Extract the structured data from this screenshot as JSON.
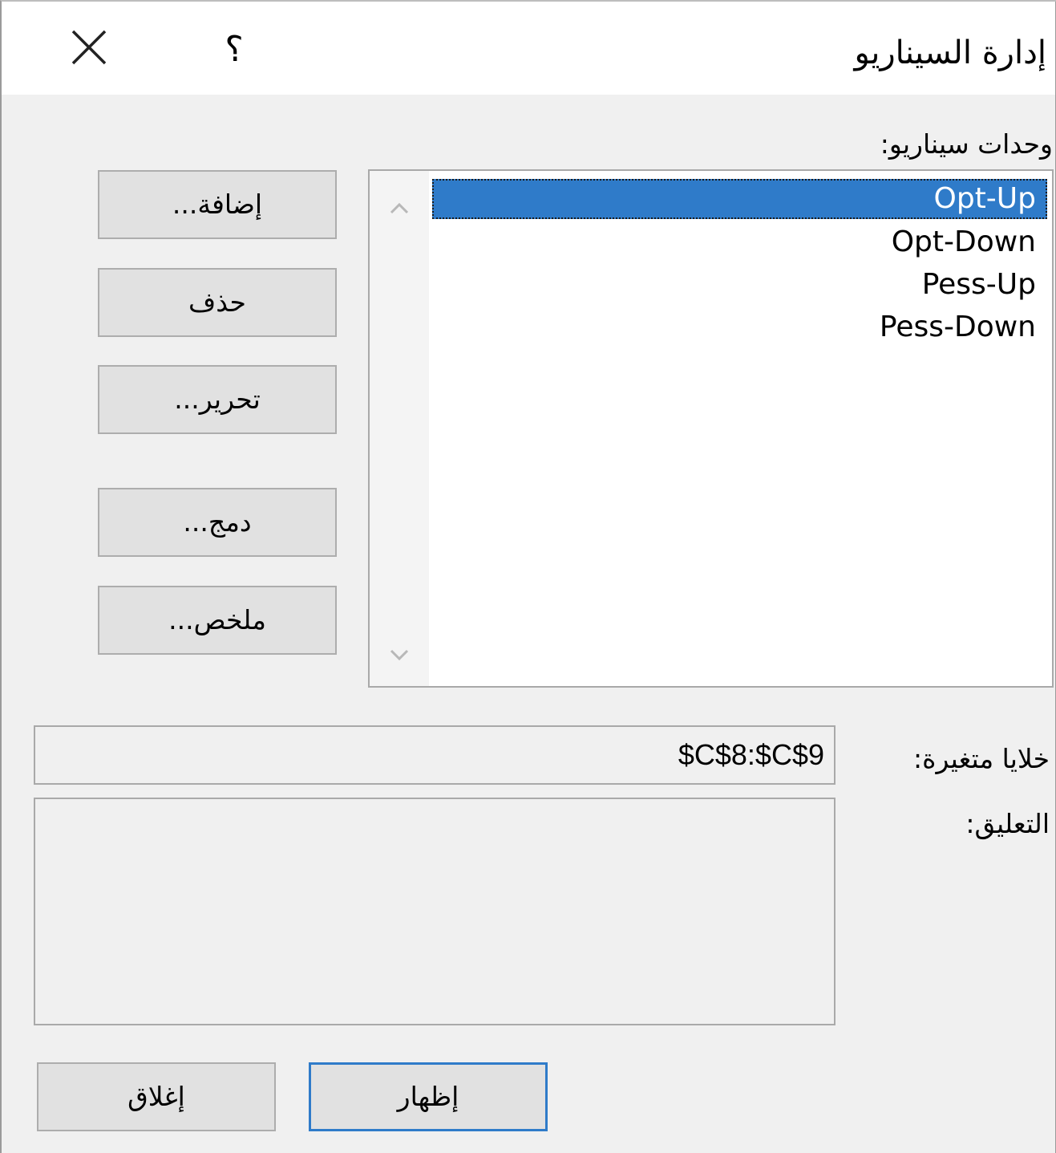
{
  "window": {
    "title": "إدارة السيناريو",
    "help_label": "؟",
    "close_icon": "close-icon"
  },
  "scenarios": {
    "label": "وحدات سيناريو:",
    "items": [
      "Opt-Up",
      "Opt-Down",
      "Pess-Up",
      "Pess-Down"
    ],
    "selected": "Opt-Up",
    "scroll_up_icon": "chevron-up-icon",
    "scroll_down_icon": "chevron-down-icon"
  },
  "buttons": {
    "add": "إضافة...",
    "delete": "حذف",
    "edit": "تحرير...",
    "merge": "دمج...",
    "summary": "ملخص..."
  },
  "changing_cells": {
    "label": "خلايا متغيرة:",
    "value": "$C$8:$C$9"
  },
  "comment": {
    "label": "التعليق:",
    "value": ""
  },
  "footer": {
    "show": "إظهار",
    "close": "إغلاق"
  },
  "colors": {
    "selection": "#2f7bc9",
    "default_button_border": "#2f7bc9",
    "dialog_bg": "#f0f0f0"
  }
}
